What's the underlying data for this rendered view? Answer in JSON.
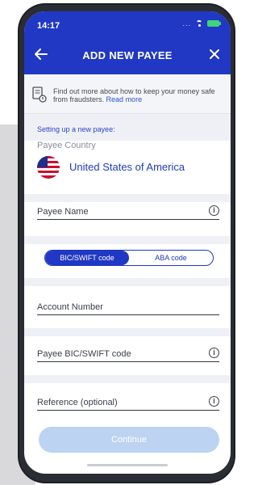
{
  "status": {
    "time": "14:17",
    "dots": "..."
  },
  "header": {
    "title": "ADD NEW PAYEE"
  },
  "banner": {
    "text": "Find out more about how to keep your money safe from fraudsters.",
    "link": "Read more"
  },
  "form": {
    "section_caption": "Setting up a new payee:",
    "country_label": "Payee Country",
    "country_value": "United States of America",
    "payee_name": "Payee Name",
    "code_toggle": {
      "options": [
        "BIC/SWIFT code",
        "ABA code"
      ],
      "selected": "BIC/SWIFT code"
    },
    "account_number": "Account Number",
    "payee_bic": "Payee BIC/SWIFT code",
    "reference": "Reference (optional)"
  },
  "actions": {
    "continue": "Continue"
  },
  "colors": {
    "brand": "#2038c4",
    "continue_disabled": "#bcd3f1"
  }
}
